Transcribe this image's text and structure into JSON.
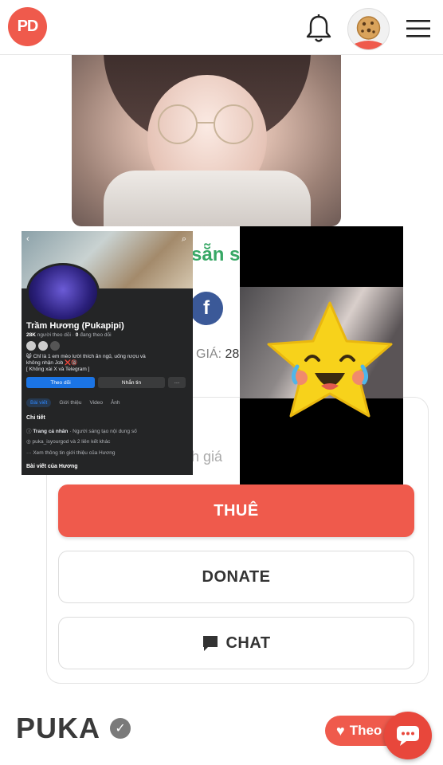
{
  "header": {
    "logo_text": "PD",
    "brand_color": "#ef5a4c",
    "icons": [
      "bell-icon",
      "cookie-avatar",
      "hamburger-menu-icon"
    ]
  },
  "profile_section": {
    "partial_title": "sẵn s",
    "facebook_icon_label": "f",
    "price_label": "GIÁ:",
    "price_value": "28",
    "rating_text": "h giá"
  },
  "actions": {
    "rent_label": "THUÊ",
    "donate_label": "DONATE",
    "chat_label": "CHAT"
  },
  "fb_screenshot": {
    "back": "‹",
    "search": "⌕",
    "name": "Trầm Hương (Pukapipi)",
    "followers_count": "28K",
    "followers_label": "người theo dõi",
    "following_count": "0",
    "following_label": "đang theo dõi",
    "bio_line1": "😸 Chỉ là 1 em mèo lười thích ăn ngủ, uống rượu và",
    "bio_line2": "không nhận Job ❌🔞",
    "bio_line3": "[ Không xài X và Telegram ]",
    "follow_btn": "Theo dõi",
    "message_btn": "Nhắn tin",
    "more_btn": "···",
    "tabs": [
      "Bài viết",
      "Giới thiệu",
      "Video",
      "Ảnh"
    ],
    "details_title": "Chi tiết",
    "detail_1_bold": "Trang cá nhân",
    "detail_1_rest": " · Người sáng tạo nội dung số",
    "detail_2": "puka_isyourgod và 2 liên kết khác",
    "detail_3": "Xem thông tin giới thiệu của Hương",
    "posts_title": "Bài viết của Hương"
  },
  "footer": {
    "username": "PUKA",
    "verified_mark": "✓",
    "follow_label": "Theo",
    "heart": "♥"
  }
}
